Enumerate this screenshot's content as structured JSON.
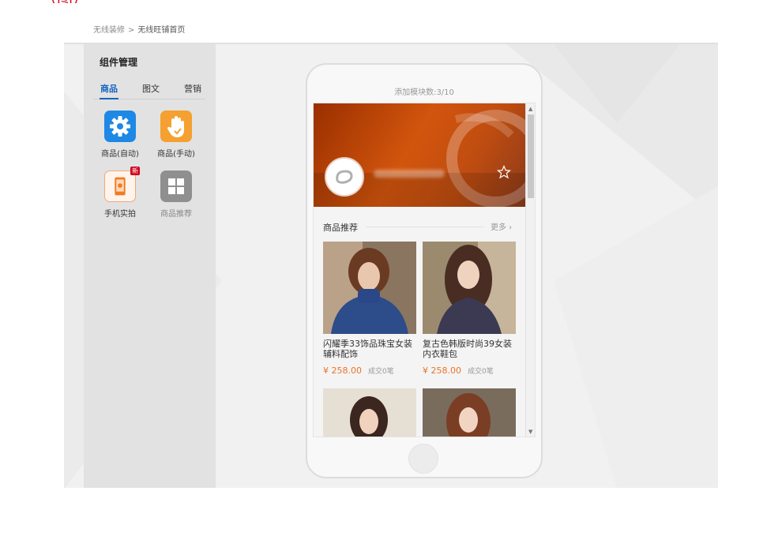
{
  "breadcrumb": {
    "parent": "无线装修",
    "separator": ">",
    "current": "无线旺铺首页"
  },
  "panel": {
    "title": "组件管理",
    "tabs": [
      {
        "label": "商品",
        "active": true
      },
      {
        "label": "图文",
        "active": false
      },
      {
        "label": "营销",
        "active": false
      }
    ],
    "components": [
      {
        "label": "商品(自动)",
        "icon": "gear-icon",
        "color": "#1e88e5"
      },
      {
        "label": "商品(手动)",
        "icon": "hand-icon",
        "color": "#f5a030"
      },
      {
        "label": "手机实拍",
        "icon": "phone-camera-icon",
        "color": "#f07b22",
        "badge": "新"
      },
      {
        "label": "商品推荐",
        "icon": "grid-icon",
        "color": "#8f8f8f"
      }
    ]
  },
  "phone": {
    "module_count": "添加模块数:3/10",
    "section": {
      "title": "商品推荐",
      "more": "更多 ›"
    },
    "products": [
      {
        "name": "闪耀季33饰品珠宝女装辅料配饰",
        "price": "¥ 258.00",
        "sold": "成交0笔"
      },
      {
        "name": "复古色韩版时尚39女装内衣鞋包",
        "price": "¥ 258.00",
        "sold": "成交0笔"
      }
    ]
  },
  "colors": {
    "accent": "#1565c0",
    "price": "#e8742a",
    "badge": "#d0021b"
  }
}
